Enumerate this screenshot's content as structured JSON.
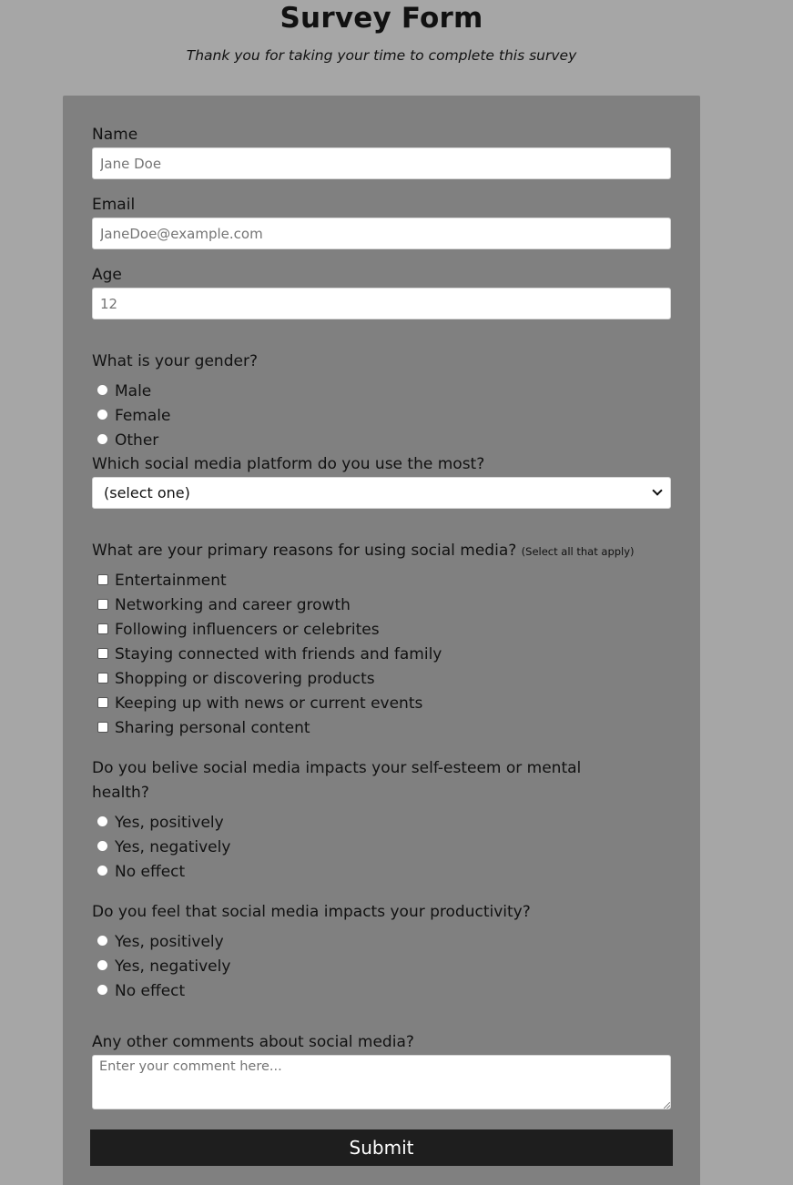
{
  "header": {
    "title": "Survey Form",
    "description": "Thank you for taking your time to complete this survey"
  },
  "form": {
    "name": {
      "label": "Name",
      "placeholder": "Jane Doe"
    },
    "email": {
      "label": "Email",
      "placeholder": "JaneDoe@example.com"
    },
    "age": {
      "label": "Age",
      "placeholder": "12"
    },
    "gender": {
      "question": "What is your gender?",
      "options": [
        "Male",
        "Female",
        "Other"
      ]
    },
    "platform": {
      "question": "Which social media platform do you use the most?",
      "selected": "(select one)"
    },
    "reasons": {
      "question": "What are your primary reasons for using social media?",
      "hint": "(Select all that apply)",
      "options": [
        "Entertainment",
        "Networking and career growth",
        "Following influencers or celebrites",
        "Staying connected with friends and family",
        "Shopping or discovering products",
        "Keeping up with news or current events",
        "Sharing personal content"
      ]
    },
    "self_esteem": {
      "question_line1": "Do you belive social media impacts your self-esteem or mental",
      "question_line2": "health?",
      "options": [
        "Yes, positively",
        "Yes, negatively",
        "No effect"
      ]
    },
    "productivity": {
      "question": "Do you feel that social media impacts your productivity?",
      "options": [
        "Yes, positively",
        "Yes, negatively",
        "No effect"
      ]
    },
    "comments": {
      "label": "Any other comments about social media?",
      "placeholder": "Enter your comment here..."
    },
    "submit_label": "Submit"
  },
  "colors": {
    "page_background": "#a6a6a6",
    "form_background": "#808080",
    "submit_background": "#1e1e1e"
  }
}
